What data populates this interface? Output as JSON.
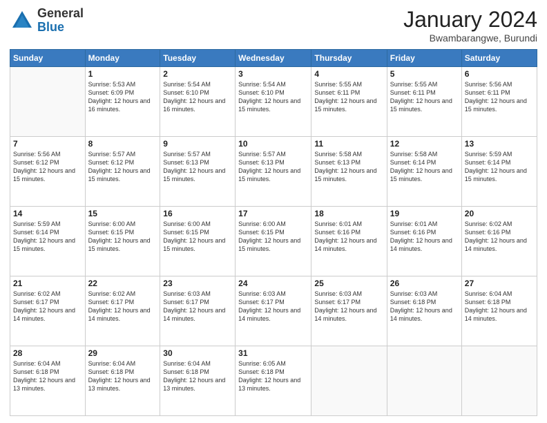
{
  "logo": {
    "general": "General",
    "blue": "Blue"
  },
  "header": {
    "month": "January 2024",
    "location": "Bwambarangwe, Burundi"
  },
  "weekdays": [
    "Sunday",
    "Monday",
    "Tuesday",
    "Wednesday",
    "Thursday",
    "Friday",
    "Saturday"
  ],
  "weeks": [
    [
      {
        "day": "",
        "sunrise": "",
        "sunset": "",
        "daylight": ""
      },
      {
        "day": "1",
        "sunrise": "Sunrise: 5:53 AM",
        "sunset": "Sunset: 6:09 PM",
        "daylight": "Daylight: 12 hours and 16 minutes."
      },
      {
        "day": "2",
        "sunrise": "Sunrise: 5:54 AM",
        "sunset": "Sunset: 6:10 PM",
        "daylight": "Daylight: 12 hours and 16 minutes."
      },
      {
        "day": "3",
        "sunrise": "Sunrise: 5:54 AM",
        "sunset": "Sunset: 6:10 PM",
        "daylight": "Daylight: 12 hours and 15 minutes."
      },
      {
        "day": "4",
        "sunrise": "Sunrise: 5:55 AM",
        "sunset": "Sunset: 6:11 PM",
        "daylight": "Daylight: 12 hours and 15 minutes."
      },
      {
        "day": "5",
        "sunrise": "Sunrise: 5:55 AM",
        "sunset": "Sunset: 6:11 PM",
        "daylight": "Daylight: 12 hours and 15 minutes."
      },
      {
        "day": "6",
        "sunrise": "Sunrise: 5:56 AM",
        "sunset": "Sunset: 6:11 PM",
        "daylight": "Daylight: 12 hours and 15 minutes."
      }
    ],
    [
      {
        "day": "7",
        "sunrise": "Sunrise: 5:56 AM",
        "sunset": "Sunset: 6:12 PM",
        "daylight": "Daylight: 12 hours and 15 minutes."
      },
      {
        "day": "8",
        "sunrise": "Sunrise: 5:57 AM",
        "sunset": "Sunset: 6:12 PM",
        "daylight": "Daylight: 12 hours and 15 minutes."
      },
      {
        "day": "9",
        "sunrise": "Sunrise: 5:57 AM",
        "sunset": "Sunset: 6:13 PM",
        "daylight": "Daylight: 12 hours and 15 minutes."
      },
      {
        "day": "10",
        "sunrise": "Sunrise: 5:57 AM",
        "sunset": "Sunset: 6:13 PM",
        "daylight": "Daylight: 12 hours and 15 minutes."
      },
      {
        "day": "11",
        "sunrise": "Sunrise: 5:58 AM",
        "sunset": "Sunset: 6:13 PM",
        "daylight": "Daylight: 12 hours and 15 minutes."
      },
      {
        "day": "12",
        "sunrise": "Sunrise: 5:58 AM",
        "sunset": "Sunset: 6:14 PM",
        "daylight": "Daylight: 12 hours and 15 minutes."
      },
      {
        "day": "13",
        "sunrise": "Sunrise: 5:59 AM",
        "sunset": "Sunset: 6:14 PM",
        "daylight": "Daylight: 12 hours and 15 minutes."
      }
    ],
    [
      {
        "day": "14",
        "sunrise": "Sunrise: 5:59 AM",
        "sunset": "Sunset: 6:14 PM",
        "daylight": "Daylight: 12 hours and 15 minutes."
      },
      {
        "day": "15",
        "sunrise": "Sunrise: 6:00 AM",
        "sunset": "Sunset: 6:15 PM",
        "daylight": "Daylight: 12 hours and 15 minutes."
      },
      {
        "day": "16",
        "sunrise": "Sunrise: 6:00 AM",
        "sunset": "Sunset: 6:15 PM",
        "daylight": "Daylight: 12 hours and 15 minutes."
      },
      {
        "day": "17",
        "sunrise": "Sunrise: 6:00 AM",
        "sunset": "Sunset: 6:15 PM",
        "daylight": "Daylight: 12 hours and 15 minutes."
      },
      {
        "day": "18",
        "sunrise": "Sunrise: 6:01 AM",
        "sunset": "Sunset: 6:16 PM",
        "daylight": "Daylight: 12 hours and 14 minutes."
      },
      {
        "day": "19",
        "sunrise": "Sunrise: 6:01 AM",
        "sunset": "Sunset: 6:16 PM",
        "daylight": "Daylight: 12 hours and 14 minutes."
      },
      {
        "day": "20",
        "sunrise": "Sunrise: 6:02 AM",
        "sunset": "Sunset: 6:16 PM",
        "daylight": "Daylight: 12 hours and 14 minutes."
      }
    ],
    [
      {
        "day": "21",
        "sunrise": "Sunrise: 6:02 AM",
        "sunset": "Sunset: 6:17 PM",
        "daylight": "Daylight: 12 hours and 14 minutes."
      },
      {
        "day": "22",
        "sunrise": "Sunrise: 6:02 AM",
        "sunset": "Sunset: 6:17 PM",
        "daylight": "Daylight: 12 hours and 14 minutes."
      },
      {
        "day": "23",
        "sunrise": "Sunrise: 6:03 AM",
        "sunset": "Sunset: 6:17 PM",
        "daylight": "Daylight: 12 hours and 14 minutes."
      },
      {
        "day": "24",
        "sunrise": "Sunrise: 6:03 AM",
        "sunset": "Sunset: 6:17 PM",
        "daylight": "Daylight: 12 hours and 14 minutes."
      },
      {
        "day": "25",
        "sunrise": "Sunrise: 6:03 AM",
        "sunset": "Sunset: 6:17 PM",
        "daylight": "Daylight: 12 hours and 14 minutes."
      },
      {
        "day": "26",
        "sunrise": "Sunrise: 6:03 AM",
        "sunset": "Sunset: 6:18 PM",
        "daylight": "Daylight: 12 hours and 14 minutes."
      },
      {
        "day": "27",
        "sunrise": "Sunrise: 6:04 AM",
        "sunset": "Sunset: 6:18 PM",
        "daylight": "Daylight: 12 hours and 14 minutes."
      }
    ],
    [
      {
        "day": "28",
        "sunrise": "Sunrise: 6:04 AM",
        "sunset": "Sunset: 6:18 PM",
        "daylight": "Daylight: 12 hours and 13 minutes."
      },
      {
        "day": "29",
        "sunrise": "Sunrise: 6:04 AM",
        "sunset": "Sunset: 6:18 PM",
        "daylight": "Daylight: 12 hours and 13 minutes."
      },
      {
        "day": "30",
        "sunrise": "Sunrise: 6:04 AM",
        "sunset": "Sunset: 6:18 PM",
        "daylight": "Daylight: 12 hours and 13 minutes."
      },
      {
        "day": "31",
        "sunrise": "Sunrise: 6:05 AM",
        "sunset": "Sunset: 6:18 PM",
        "daylight": "Daylight: 12 hours and 13 minutes."
      },
      {
        "day": "",
        "sunrise": "",
        "sunset": "",
        "daylight": ""
      },
      {
        "day": "",
        "sunrise": "",
        "sunset": "",
        "daylight": ""
      },
      {
        "day": "",
        "sunrise": "",
        "sunset": "",
        "daylight": ""
      }
    ]
  ]
}
